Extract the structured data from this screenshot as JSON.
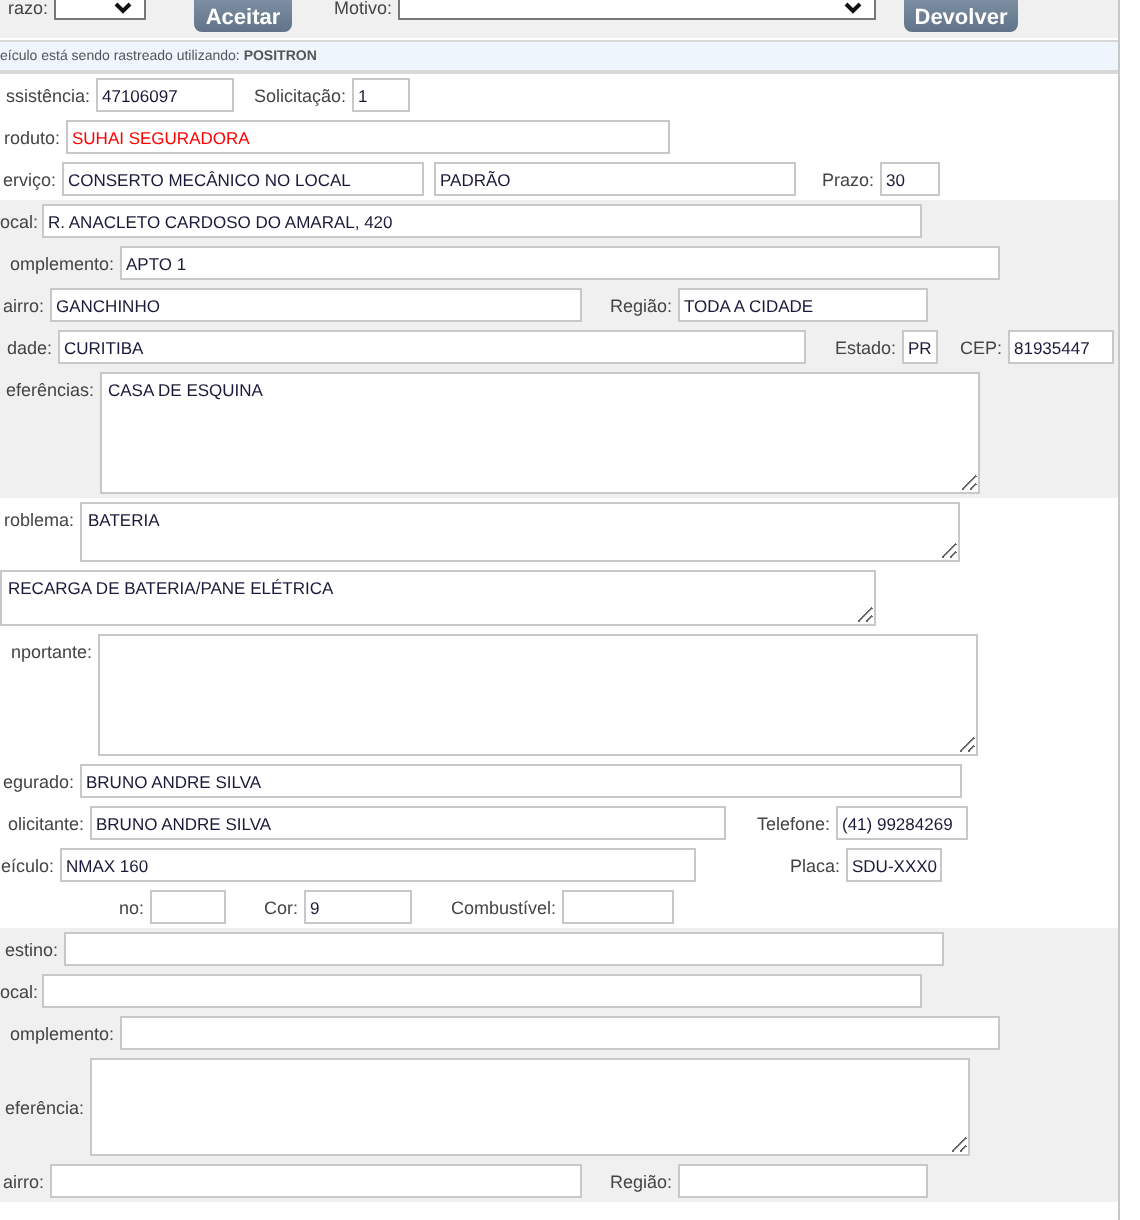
{
  "top_bar": {
    "items": [
      {
        "kind": "label",
        "text": "razo:"
      },
      {
        "kind": "select"
      },
      {
        "kind": "button",
        "text": "Aceitar"
      },
      {
        "kind": "label",
        "text": "Motivo:"
      },
      {
        "kind": "select"
      },
      {
        "kind": "button",
        "text": "Devolver"
      }
    ]
  },
  "tracking_notice": "eículo está sendo rastreado utilizando: **POSITRON**",
  "sections": [
    {
      "shaded": false,
      "rows": [
        {
          "items": [
            {
              "kind": "label",
              "text": "ssistência:"
            },
            {
              "kind": "input",
              "value": "47106097"
            },
            {
              "kind": "label",
              "text": "Solicitação:"
            },
            {
              "kind": "input",
              "value": "1"
            }
          ]
        },
        {
          "items": [
            {
              "kind": "label",
              "text": "roduto:"
            },
            {
              "kind": "input",
              "value": "SUHAI SEGURADORA",
              "alert": true
            }
          ]
        },
        {
          "items": [
            {
              "kind": "label",
              "text": "erviço:"
            },
            {
              "kind": "input",
              "value": "CONSERTO MECÂNICO NO LOCAL"
            },
            {
              "kind": "input",
              "value": "PADRÃO"
            },
            {
              "kind": "label",
              "text": "Prazo:"
            },
            {
              "kind": "input",
              "value": "30"
            }
          ]
        }
      ]
    },
    {
      "shaded": true,
      "rows": [
        {
          "items": [
            {
              "kind": "label",
              "text": "ocal:"
            },
            {
              "kind": "input",
              "value": "R. ANACLETO CARDOSO DO AMARAL, 420"
            }
          ]
        },
        {
          "items": [
            {
              "kind": "label",
              "text": "omplemento:"
            },
            {
              "kind": "input",
              "value": "APTO 1"
            }
          ]
        },
        {
          "items": [
            {
              "kind": "label",
              "text": "airro:"
            },
            {
              "kind": "input",
              "value": "GANCHINHO"
            },
            {
              "kind": "label",
              "text": "Região:"
            },
            {
              "kind": "input",
              "value": "TODA A CIDADE"
            }
          ]
        },
        {
          "items": [
            {
              "kind": "label",
              "text": "dade:"
            },
            {
              "kind": "input",
              "value": "CURITIBA"
            },
            {
              "kind": "label",
              "text": "Estado:"
            },
            {
              "kind": "input",
              "value": "PR"
            },
            {
              "kind": "label",
              "text": "CEP:"
            },
            {
              "kind": "input",
              "value": "81935447"
            }
          ]
        },
        {
          "items": [
            {
              "kind": "label",
              "text": "eferências:"
            },
            {
              "kind": "textarea",
              "value": "CASA DE ESQUINA"
            }
          ]
        }
      ]
    },
    {
      "shaded": false,
      "rows": [
        {
          "items": [
            {
              "kind": "label",
              "text": "roblema:"
            },
            {
              "kind": "textarea",
              "value": "BATERIA"
            }
          ]
        },
        {
          "items": [
            {
              "kind": "textarea",
              "value": "RECARGA DE BATERIA/PANE ELÉTRICA"
            }
          ]
        },
        {
          "items": [
            {
              "kind": "label",
              "text": "nportante:"
            },
            {
              "kind": "textarea"
            }
          ]
        },
        {
          "items": [
            {
              "kind": "label",
              "text": "egurado:"
            },
            {
              "kind": "input",
              "value": "BRUNO ANDRE SILVA"
            }
          ]
        },
        {
          "items": [
            {
              "kind": "label",
              "text": "olicitante:"
            },
            {
              "kind": "input",
              "value": "BRUNO ANDRE SILVA"
            },
            {
              "kind": "label",
              "text": "Telefone:"
            },
            {
              "kind": "input",
              "value": "(41) 99284269"
            }
          ]
        },
        {
          "items": [
            {
              "kind": "label",
              "text": "eículo:"
            },
            {
              "kind": "input",
              "value": "NMAX 160"
            },
            {
              "kind": "label",
              "text": "Placa:"
            },
            {
              "kind": "input",
              "value": "SDU-XXX0"
            }
          ]
        },
        {
          "items": [
            {
              "kind": "label",
              "text": "no:"
            },
            {
              "kind": "input"
            },
            {
              "kind": "label",
              "text": "Cor:"
            },
            {
              "kind": "input",
              "value": "9"
            },
            {
              "kind": "label",
              "text": "Combustível:"
            },
            {
              "kind": "input"
            }
          ]
        }
      ]
    },
    {
      "shaded": true,
      "rows": [
        {
          "items": [
            {
              "kind": "label",
              "text": "estino:"
            },
            {
              "kind": "input"
            }
          ]
        },
        {
          "items": [
            {
              "kind": "label",
              "text": "ocal:"
            },
            {
              "kind": "input"
            }
          ]
        },
        {
          "items": [
            {
              "kind": "label",
              "text": "omplemento:"
            },
            {
              "kind": "input"
            }
          ]
        },
        {
          "items": [
            {
              "kind": "label",
              "text": "eferência:"
            },
            {
              "kind": "textarea"
            }
          ]
        },
        {
          "items": [
            {
              "kind": "label",
              "text": "airro:"
            },
            {
              "kind": "input"
            },
            {
              "kind": "label",
              "text": "Região:"
            },
            {
              "kind": "input"
            }
          ]
        }
      ]
    }
  ]
}
